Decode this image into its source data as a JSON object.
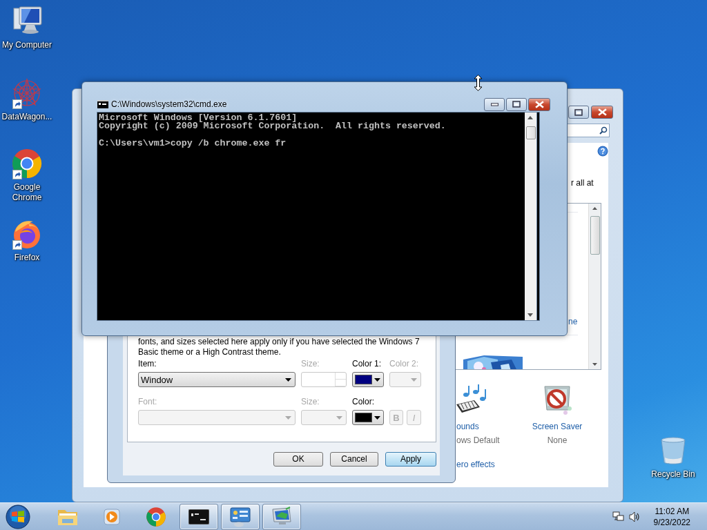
{
  "desktop_icons": [
    {
      "label": "My Computer",
      "kind": "computer",
      "shortcut": false
    },
    {
      "label": "DataWagon...",
      "kind": "datawagon",
      "shortcut": true
    },
    {
      "label": "Google Chrome",
      "kind": "chrome",
      "shortcut": true
    },
    {
      "label": "Firefox",
      "kind": "firefox",
      "shortcut": true
    },
    {
      "label": "Recycle Bin",
      "kind": "recycle",
      "shortcut": false
    }
  ],
  "personalization_window": {
    "intro_fragment": "r all at",
    "theme_link_fragment": "ne",
    "items": [
      {
        "kind": "sounds",
        "label": "ounds",
        "value": "ows Default"
      },
      {
        "kind": "screen_saver",
        "label": "Screen Saver",
        "value": "None"
      }
    ],
    "effects_link_fragment": "ero effects"
  },
  "appearance_dialog": {
    "description": "fonts, and sizes selected here apply only if you have selected the Windows 7 Basic theme or a High Contrast theme.",
    "rows": [
      [
        {
          "kind": "combo",
          "label": "Item:",
          "value": "Window",
          "disabled": false
        },
        {
          "kind": "spin",
          "label": "Size:",
          "disabled": true
        },
        {
          "kind": "color",
          "label": "Color 1:",
          "color": "#000080",
          "disabled": false
        },
        {
          "kind": "combo",
          "label": "Color 2:",
          "disabled": true
        }
      ],
      [
        {
          "kind": "combo",
          "label": "Font:",
          "disabled": true
        },
        {
          "kind": "combo",
          "label": "Size:",
          "disabled": true
        },
        {
          "kind": "color",
          "label": "Color:",
          "color": "#000000",
          "disabled": false
        },
        {
          "kind": "toggle",
          "text": "B",
          "disabled": true
        },
        {
          "kind": "toggle",
          "text": "I",
          "disabled": true
        }
      ]
    ],
    "buttons": [
      {
        "label": "OK",
        "focused": false
      },
      {
        "label": "Cancel",
        "focused": false
      },
      {
        "label": "Apply",
        "focused": true
      }
    ]
  },
  "cmd_window": {
    "title": "C:\\Windows\\system32\\cmd.exe",
    "output": [
      "Microsoft Windows [Version 6.1.7601]",
      "Copyright (c) 2009 Microsoft Corporation.  All rights reserved."
    ],
    "prompt": "C:\\Users\\vm1>copy /b chrome.exe fr"
  },
  "taskbar": {
    "items": [
      {
        "kind": "explorer",
        "open": false
      },
      {
        "kind": "media_player",
        "open": false
      },
      {
        "kind": "chrome",
        "open": false
      },
      {
        "kind": "cmd",
        "open": true
      },
      {
        "kind": "control_panel",
        "open": true
      },
      {
        "kind": "display",
        "open": true
      }
    ],
    "time": "11:02 AM",
    "date": "9/23/2022"
  }
}
